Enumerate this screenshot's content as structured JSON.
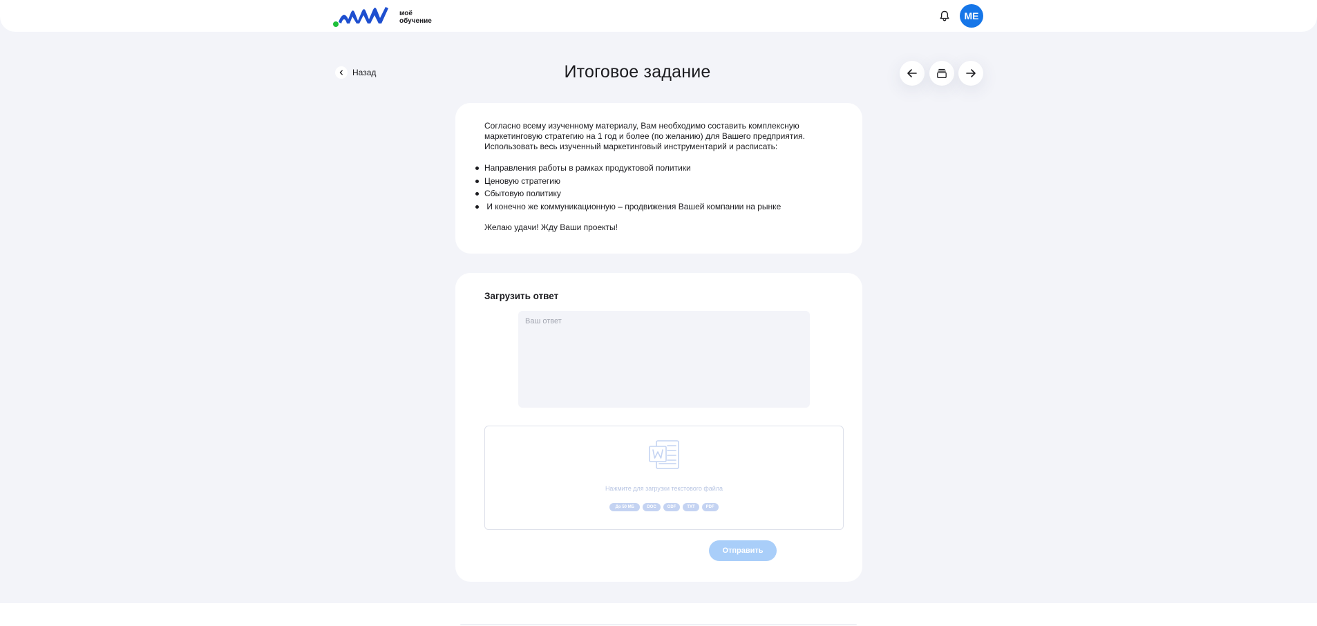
{
  "header": {
    "logo_line1": "моё",
    "logo_line2": "обучение",
    "avatar_initials": "МЕ",
    "brand_colors": {
      "blue": "#1e4fcf",
      "green": "#1fbf3a",
      "accent": "#1676e8"
    }
  },
  "nav": {
    "back_label": "Назад"
  },
  "page": {
    "title": "Итоговое задание"
  },
  "task": {
    "intro": "Согласно всему изученному материалу, Вам необходимо составить комплексную маркетинговую стратегию на 1 год и более (по желанию) для Вашего предприятия. Использовать весь изученный маркетинговый инструментарий и расписать:",
    "items": [
      "Направления работы в рамках продуктовой политики",
      "Ценовую стратегию",
      "Сбытовую политику",
      " И конечно же коммуникационную – продвижения Вашей компании на рынке"
    ],
    "closing": "Желаю удачи! Жду Ваши проекты!"
  },
  "answer": {
    "heading": "Загрузить ответ",
    "placeholder": "Ваш ответ",
    "upload_hint": "Нажмите для загрузки текстового файла",
    "formats": [
      "До 50 МБ",
      "DOC",
      "ODF",
      "TXT",
      "PDF"
    ],
    "submit_label": "Отправить"
  }
}
